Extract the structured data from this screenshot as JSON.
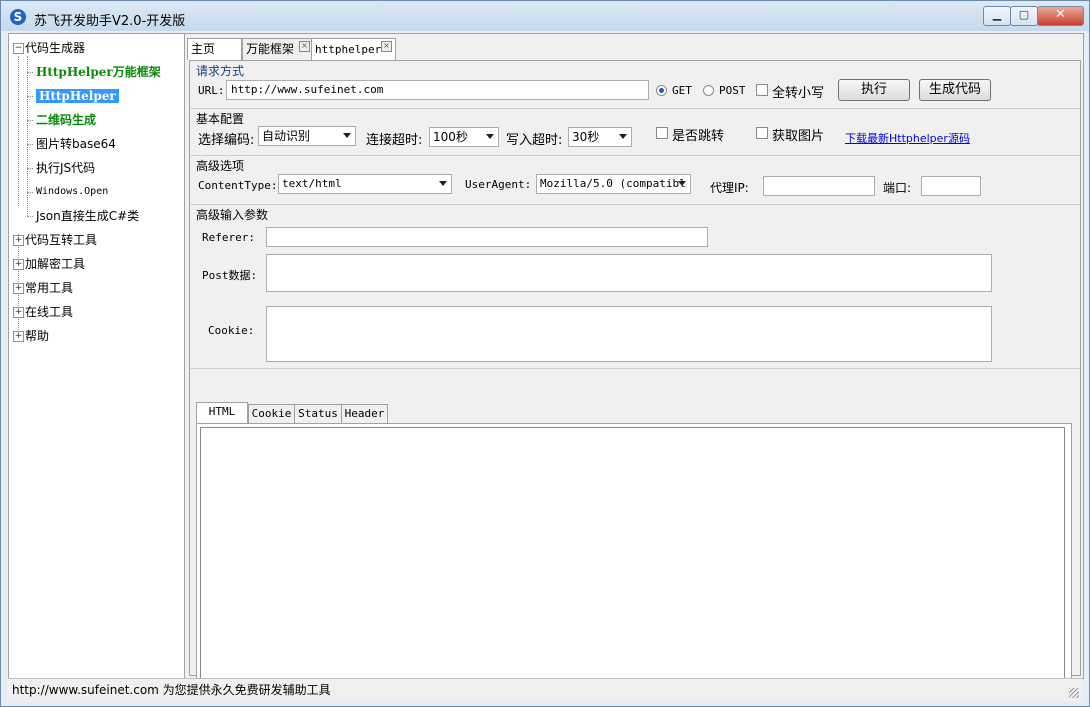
{
  "window": {
    "title": "苏飞开发助手V2.0-开发版",
    "app_icon_letter": "S"
  },
  "tree": {
    "roots": [
      {
        "label": "代码生成器",
        "expander": "−"
      },
      {
        "label": "代码互转工具",
        "expander": "+"
      },
      {
        "label": "加解密工具",
        "expander": "+"
      },
      {
        "label": "常用工具",
        "expander": "+"
      },
      {
        "label": "在线工具",
        "expander": "+"
      },
      {
        "label": "帮助",
        "expander": "+"
      }
    ],
    "children": [
      {
        "label": "HttpHelper万能框架"
      },
      {
        "label": "HttpHelper"
      },
      {
        "label": "二维码生成"
      },
      {
        "label": "图片转base64"
      },
      {
        "label": "执行JS代码"
      },
      {
        "label": "Windows.Open"
      },
      {
        "label": "Json直接生成C#类"
      }
    ]
  },
  "tabs": [
    {
      "label": "主页"
    },
    {
      "label": "万能框架",
      "close": "×"
    },
    {
      "label": "httphelper",
      "close": "×"
    }
  ],
  "request": {
    "group_label": "请求方式",
    "url_label": "URL:",
    "url_value": "http://www.sufeinet.com",
    "get_label": "GET",
    "post_label": "POST",
    "lowercase_label": "全转小写",
    "execute_button": "执行",
    "generate_button": "生成代码",
    "method": "GET"
  },
  "basic": {
    "group_label": "基本配置",
    "encoding_label": "选择编码:",
    "encoding_value": "自动识别",
    "conn_timeout_label": "连接超时:",
    "conn_timeout_value": "100秒",
    "write_timeout_label": "写入超时:",
    "write_timeout_value": "30秒",
    "redirect_label": "是否跳转",
    "image_label": "获取图片",
    "download_link": "下载最新Httphelper源码"
  },
  "advanced": {
    "group_label": "高级选项",
    "content_type_label": "ContentType:",
    "content_type_value": "text/html",
    "user_agent_label": "UserAgent:",
    "user_agent_value": "Mozilla/5.0 (compatibl",
    "proxy_label": "代理IP:",
    "proxy_value": "",
    "port_label": "端口:",
    "port_value": ""
  },
  "params": {
    "group_label": "高级输入参数",
    "referer_label": "Referer:",
    "referer_value": "",
    "post_label": "Post数据:",
    "cookie_label": "Cookie:"
  },
  "result_tabs": [
    {
      "label": "HTML"
    },
    {
      "label": "Cookie"
    },
    {
      "label": "Status"
    },
    {
      "label": "Header"
    }
  ],
  "status": {
    "text": "http://www.sufeinet.com 为您提供永久免费研发辅助工具"
  },
  "colors": {
    "accent": "#3399ff",
    "tree_green": "#0a8a0a",
    "link": "#0000ee",
    "close": "#c7402b"
  },
  "icons": {
    "minimize": "minimize-icon",
    "maximize": "maximize-icon",
    "close": "close-icon"
  }
}
